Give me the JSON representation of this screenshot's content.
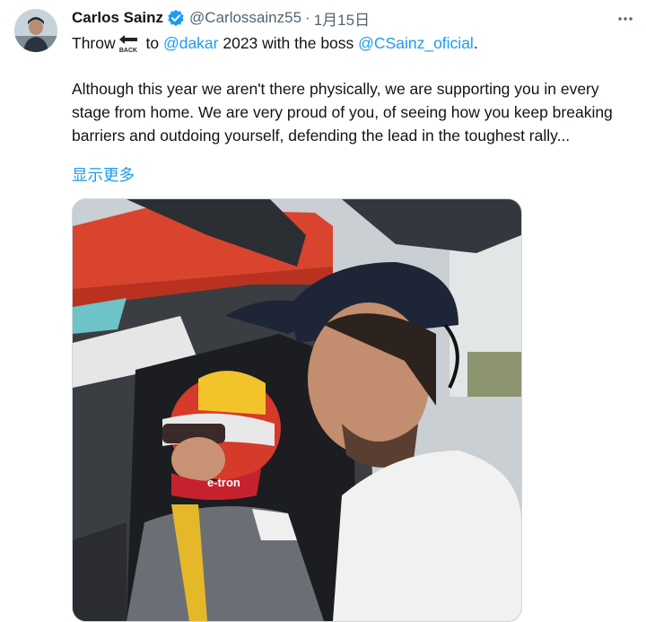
{
  "tweet": {
    "author_name": "Carlos Sainz",
    "handle": "@Carlossainz55",
    "separator": "·",
    "date": "1月15日",
    "line1": {
      "prefix": "Throw",
      "emoji_label": "BACK",
      "to": " to ",
      "mention1": "@dakar",
      "middle": " 2023 with the boss ",
      "mention2": "@CSainz_oficial",
      "suffix": "."
    },
    "body": "Although this year we aren't there physically, we are supporting you in every stage from home. We are very proud of you, of seeing how you keep breaking barriers and outdoing yourself, defending the lead in the toughest rally...",
    "show_more": "显示更多",
    "photo_logo_text": "e-tron"
  },
  "colors": {
    "link": "#1d9bf0",
    "text": "#0f1419",
    "secondary": "#536471",
    "verified": "#1d9bf0"
  },
  "icons": {
    "verified": "verified-badge-icon",
    "more": "more-horizontal-icon",
    "back": "back-arrow-emoji"
  }
}
